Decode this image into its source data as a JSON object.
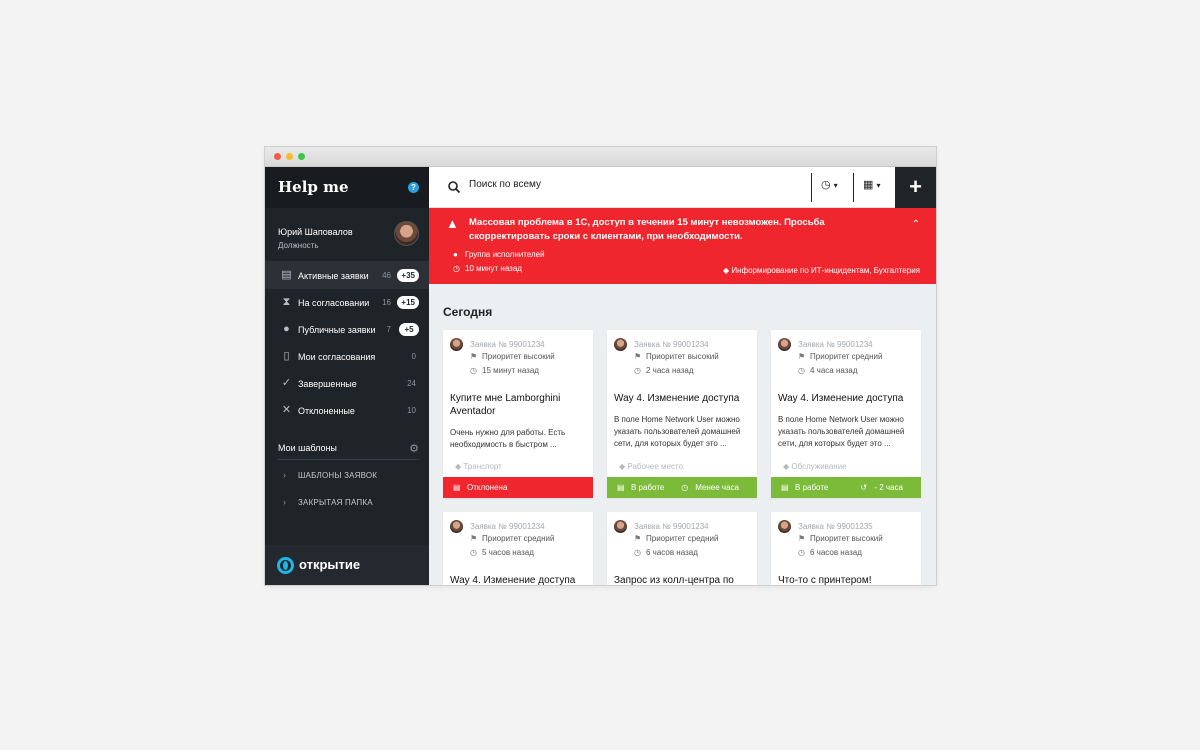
{
  "app": {
    "title": "Help me",
    "help_icon": "?"
  },
  "user": {
    "name": "Юрий Шаповалов",
    "role": "Должность"
  },
  "nav": [
    {
      "label": "Активные заявки",
      "count": "46",
      "badge": "+35",
      "icon": "inbox-icon"
    },
    {
      "label": "На согласовании",
      "count": "16",
      "badge": "+15",
      "icon": "hourglass-icon"
    },
    {
      "label": "Публичные заявки",
      "count": "7",
      "badge": "+5",
      "icon": "person-icon"
    },
    {
      "label": "Мои согласования",
      "count": "0",
      "icon": "document-icon"
    },
    {
      "label": "Завершенные",
      "count": "24",
      "icon": "check-icon"
    },
    {
      "label": "Отклоненные",
      "count": "10",
      "icon": "cross-icon"
    }
  ],
  "templates": {
    "title": "Мои шаблоны",
    "folders": [
      "ШАБЛОНЫ ЗАЯВОК",
      "ЗАКРЫТАЯ ПАПКА"
    ]
  },
  "brand": {
    "name": "открытие"
  },
  "search": {
    "placeholder": "Поиск по всему"
  },
  "toolbar": {
    "add_label": "+",
    "clock_icon": "◷",
    "grid_icon": "▦",
    "caret": "▾"
  },
  "alert": {
    "text": "Массовая проблема в 1С, доступ в течении 15 минут невозможен. Просьба скорректировать сроки с клиентами, при необходимости.",
    "group": "Группа исполнителей",
    "time": "10 минут назад",
    "tag": "Информирование по ИТ-инцидентам, Бухгалтерия",
    "collapse": "⌃"
  },
  "section": {
    "title": "Сегодня"
  },
  "cards": [
    {
      "number": "Заявка № 99001234",
      "priority": "Приоритет высокий",
      "time": "15 минут назад",
      "title": "Купите мне Lamborghini Aventador",
      "desc": "Очень нужно для работы. Есть необходимость в быстром ...",
      "category": "Транспорт",
      "status": "Отклонена",
      "status_extra": "",
      "status_color": "#f0262f"
    },
    {
      "number": "Заявка № 99001234",
      "priority": "Приоритет высокий",
      "time": "2 часа назад",
      "title": "Way 4. Изменение доступа",
      "desc": "В поле Home Network User можно указать пользователей домашней сети, для которых будет это ...",
      "category": "Рабочее место",
      "status": "В работе",
      "status_extra": "Менее часа",
      "status_color": "#7cbb3a"
    },
    {
      "number": "Заявка № 99001234",
      "priority": "Приоритет средний",
      "time": "4 часа назад",
      "title": "Way 4. Изменение доступа",
      "desc": "В поле Home Network User можно указать пользователей домашней сети, для которых будет это ...",
      "category": "Обслуживание",
      "status": "В работе",
      "status_extra": "- 2 часа",
      "status_color": "#7cbb3a"
    },
    {
      "number": "Заявка № 99001234",
      "priority": "Приоритет средний",
      "time": "5 часов назад",
      "title": "Way 4. Изменение доступа"
    },
    {
      "number": "Заявка № 99001234",
      "priority": "Приоритет средний",
      "time": "6 часов назад",
      "title": "Запрос из колл-центра по"
    },
    {
      "number": "Заявка № 99001235",
      "priority": "Приоритет высокий",
      "time": "6 часов назад",
      "title": "Что-то с принтером!"
    }
  ]
}
